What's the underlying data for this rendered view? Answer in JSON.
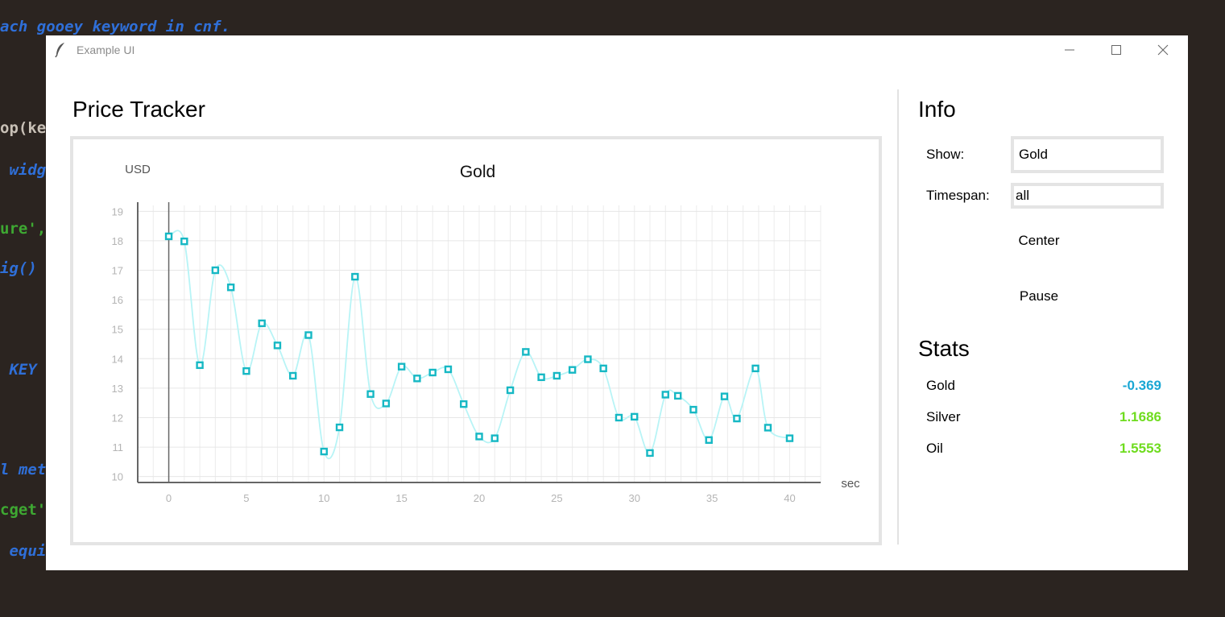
{
  "background_code": [
    {
      "text": "ach gooey keyword in cnf.",
      "color": "#2f6fd8"
    },
    {
      "text": "op(ke",
      "color": "#c8c0b6"
    },
    {
      "text": " widg",
      "color": "#2f6fd8"
    },
    {
      "text": "ure',",
      "color": "#3ea832"
    },
    {
      "text": "ig()",
      "color": "#2f6fd8"
    },
    {
      "text": " KEY",
      "color": "#2f6fd8"
    },
    {
      "text": "l met",
      "color": "#2f6fd8"
    },
    {
      "text": "cget'",
      "color": "#3ea832"
    },
    {
      "text": " equi",
      "color": "#2f6fd8"
    }
  ],
  "window": {
    "title": "Example UI",
    "icon": "feather-icon",
    "controls": [
      "minimize-icon",
      "maximize-icon",
      "close-icon"
    ]
  },
  "main": {
    "title": "Price Tracker"
  },
  "info": {
    "heading": "Info",
    "show_label": "Show:",
    "show_value": "Gold",
    "timespan_label": "Timespan:",
    "timespan_value": "all",
    "center_label": "Center",
    "pause_label": "Pause"
  },
  "stats": {
    "heading": "Stats",
    "items": [
      {
        "name": "Gold",
        "value": "-0.369",
        "color": "#1aa7d4"
      },
      {
        "name": "Silver",
        "value": "1.1686",
        "color": "#6fdc1f"
      },
      {
        "name": "Oil",
        "value": "1.5553",
        "color": "#6fdc1f"
      }
    ]
  },
  "chart_data": {
    "type": "line",
    "title": "Gold",
    "xlabel": "sec",
    "ylabel": "USD",
    "xlim": [
      -2,
      42
    ],
    "ylim": [
      9.8,
      19.2
    ],
    "xticks": [
      0,
      5,
      10,
      15,
      20,
      25,
      30,
      35,
      40
    ],
    "yticks": [
      10,
      11,
      12,
      13,
      14,
      15,
      16,
      17,
      18,
      19
    ],
    "grid": true,
    "line_color": "#b8f4f6",
    "marker_color": "#16b8c4",
    "series": [
      {
        "x": [
          0,
          1,
          2,
          3,
          4,
          5,
          6,
          7,
          8,
          9,
          10,
          11,
          12,
          13,
          14,
          15,
          16,
          17,
          18,
          19,
          20,
          21,
          22,
          23,
          24,
          25,
          26,
          27,
          28,
          29,
          30,
          31,
          32,
          32.8,
          33.8,
          34.8,
          35.8,
          36.6,
          37.8,
          38.6,
          40
        ],
        "y": [
          18.15,
          17.98,
          13.78,
          17.0,
          16.42,
          13.58,
          15.2,
          14.45,
          13.42,
          14.8,
          10.85,
          11.67,
          16.78,
          12.8,
          12.48,
          13.73,
          13.33,
          13.53,
          13.64,
          12.46,
          11.36,
          11.3,
          12.93,
          14.23,
          13.37,
          13.42,
          13.62,
          13.98,
          13.67,
          12.0,
          12.03,
          10.8,
          12.78,
          12.74,
          12.27,
          11.24,
          12.72,
          11.97,
          13.67,
          11.66,
          11.3
        ]
      }
    ]
  }
}
